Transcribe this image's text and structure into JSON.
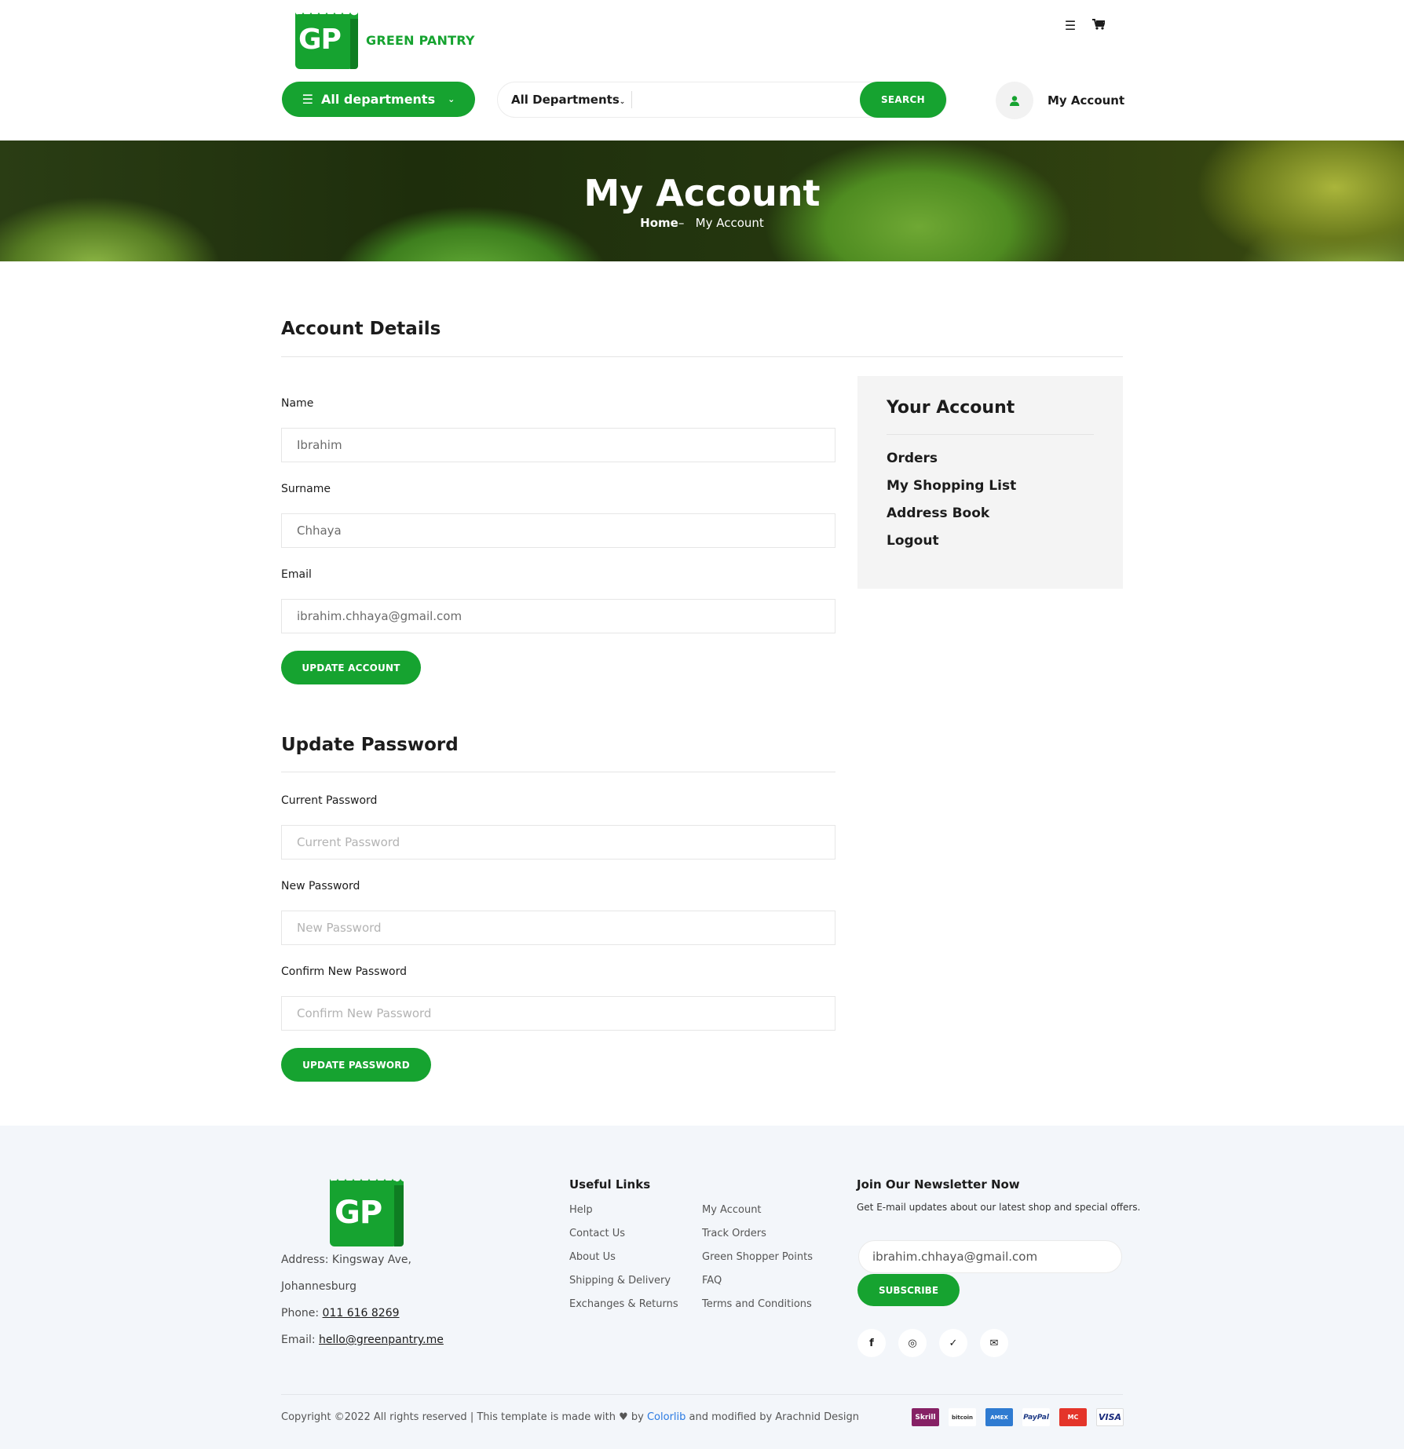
{
  "brand": {
    "logo_letters": "GP",
    "name": "GREEN PANTRY"
  },
  "header": {
    "icons": [
      "list-icon",
      "cart-icon"
    ],
    "departments_button": "All departments",
    "search": {
      "category": "All Departments",
      "button": "SEARCH",
      "query": ""
    },
    "account_label": "My Account"
  },
  "hero": {
    "title": "My Account",
    "breadcrumb_home": "Home",
    "breadcrumb_sep": "–",
    "breadcrumb_current": "My Account"
  },
  "account_details": {
    "title": "Account Details",
    "fields": [
      {
        "label": "Name",
        "value": "Ibrahim"
      },
      {
        "label": "Surname",
        "value": "Chhaya"
      },
      {
        "label": "Email",
        "value": "ibrahim.chhaya@gmail.com"
      }
    ],
    "button": "UPDATE ACCOUNT"
  },
  "update_password": {
    "title": "Update Password",
    "fields": [
      {
        "label": "Current Password",
        "placeholder": "Current Password"
      },
      {
        "label": "New Password",
        "placeholder": "New Password"
      },
      {
        "label": "Confirm New Password",
        "placeholder": "Confirm New Password"
      }
    ],
    "button": "UPDATE PASSWORD"
  },
  "sidebar": {
    "title": "Your Account",
    "links": [
      "Orders",
      "My Shopping List",
      "Address Book",
      "Logout"
    ]
  },
  "footer": {
    "logo_letters": "GP",
    "address_line1": "Address: Kingsway Ave,",
    "address_line2": "Johannesburg",
    "phone_label": "Phone: ",
    "phone": "011 616 8269",
    "email_label": "Email: ",
    "email": "hello@greenpantry.me",
    "useful_links_title": "Useful Links",
    "links_col1": [
      "Help",
      "Contact Us",
      "About Us",
      "Shipping & Delivery",
      "Exchanges & Returns"
    ],
    "links_col2": [
      "My Account",
      "Track Orders",
      "Green Shopper Points",
      "FAQ",
      "Terms and Conditions"
    ],
    "newsletter_title": "Join Our Newsletter Now",
    "newsletter_text": "Get E-mail updates about our latest shop and special offers.",
    "newsletter_email": "ibrahim.chhaya@gmail.com",
    "subscribe": "SUBSCRIBE",
    "social": [
      "f",
      "◎",
      "✓",
      "✉"
    ],
    "copyright_pre": "Copyright ©2022 All rights reserved | This template is made with",
    "copyright_by": "by",
    "copyright_colorlib": "Colorlib",
    "copyright_post": "and modified by Arachnid Design",
    "payments": [
      "Skrill",
      "bitcoin",
      "AMEX",
      "PayPal",
      "MC",
      "VISA"
    ]
  },
  "colors": {
    "accent": "#16a330",
    "footer_bg": "#f3f6fa",
    "sidebar_bg": "#f4f4f4"
  }
}
